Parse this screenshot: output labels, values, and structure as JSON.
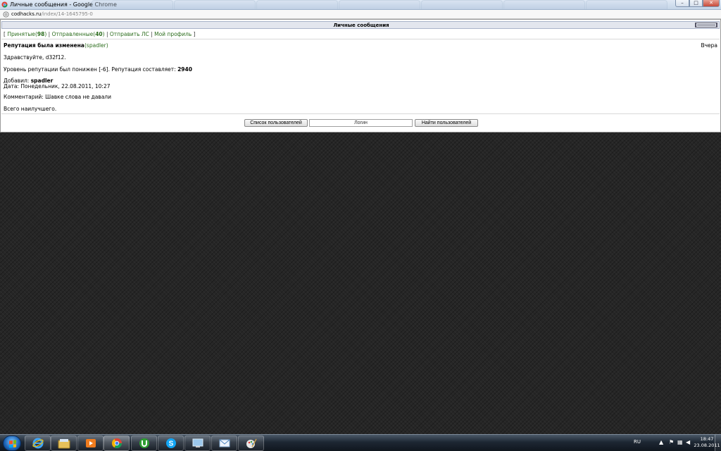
{
  "window": {
    "title": "Личные сообщения - Google Chrome",
    "controls": {
      "minimize": "–",
      "maximize": "□",
      "close": "✕"
    }
  },
  "address_bar": {
    "host": "codhacks.ru",
    "path": "/index/14-1645795-0"
  },
  "pm": {
    "header_title": "Личные сообщения",
    "nav": {
      "open_bracket": "[",
      "close_bracket": "]",
      "separator": "|",
      "inbox_label": "Принятые",
      "inbox_count": "98",
      "sent_label": "Отправленные",
      "sent_count": "40",
      "send_label": "Отправить ЛС",
      "profile_label": "Мой профиль"
    },
    "message": {
      "subject": "Репутация была изменена",
      "sender": "(spadler)",
      "when": "Вчера",
      "greeting": "Здравствуйте, d32f12.",
      "reputation_text": "Уровень репутации был понижен [-6]. Репутация составляет:",
      "reputation_value": "2940",
      "added_by_label": "Добавил:",
      "added_by_user": "spadler",
      "date_line": "Дата: Понедельник, 22.08.2011, 10:27",
      "comment_line": "Комментарий: Шавке слова не давали",
      "closing": "Всего наилучшего."
    },
    "footer": {
      "user_list_button": "Список пользователей",
      "login_placeholder": "Логин",
      "find_users_button": "Найти пользователей"
    }
  },
  "taskbar": {
    "apps": [
      {
        "icon": "internet-explorer-icon"
      },
      {
        "icon": "file-explorer-icon"
      },
      {
        "icon": "media-player-icon"
      },
      {
        "icon": "chrome-icon",
        "active": true
      },
      {
        "icon": "utorrent-icon"
      },
      {
        "icon": "skype-icon"
      },
      {
        "icon": "remote-desktop-icon"
      },
      {
        "icon": "mail-icon"
      },
      {
        "icon": "paint-icon"
      }
    ],
    "language": "RU",
    "clock_time": "18:47",
    "clock_date": "23.08.2011"
  }
}
